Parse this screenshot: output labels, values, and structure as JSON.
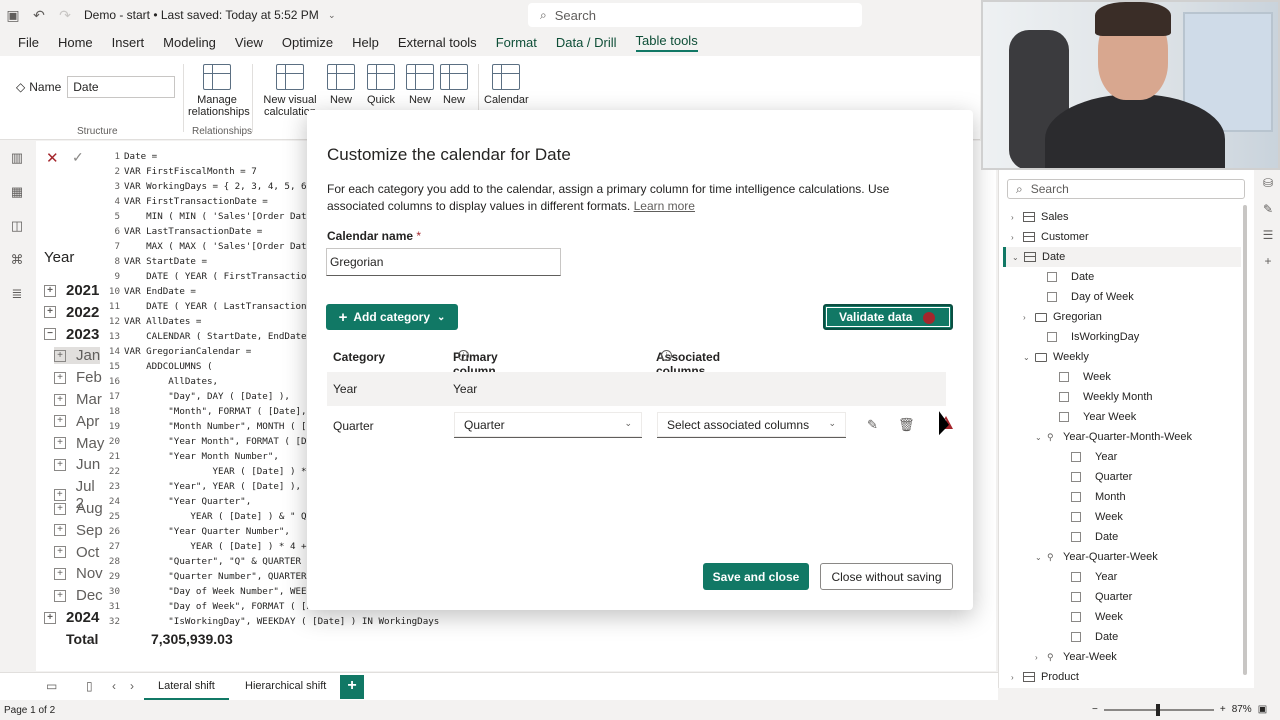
{
  "titlebar": {
    "title": "Demo - start • Last saved: Today at 5:52 PM",
    "search_placeholder": "Search"
  },
  "menu": [
    "File",
    "Home",
    "Insert",
    "Modeling",
    "View",
    "Optimize",
    "Help",
    "External tools",
    "Format",
    "Data / Drill",
    "Table tools"
  ],
  "ribbon": {
    "name_label": "Name",
    "name_value": "Date",
    "structure_label": "Structure",
    "relationships_label": "Relationships",
    "manage_rel_line1": "Manage",
    "manage_rel_line2": "relationships",
    "new_visual_line1": "New visual",
    "new_visual_line2": "calculation",
    "btn_new1": "New",
    "btn_quick": "Quick",
    "btn_new2": "New",
    "btn_new3": "New",
    "btn_calendar": "Calendar"
  },
  "code_lines": [
    {
      "n": "1",
      "t": "Date ="
    },
    {
      "n": "2",
      "t": "VAR FirstFiscalMonth = 7"
    },
    {
      "n": "3",
      "t": "VAR WorkingDays = { 2, 3, 4, 5, 6"
    },
    {
      "n": "4",
      "t": "VAR FirstTransactionDate ="
    },
    {
      "n": "5",
      "t": "    MIN ( MIN ( 'Sales'[Order Date"
    },
    {
      "n": "6",
      "t": "VAR LastTransactionDate ="
    },
    {
      "n": "7",
      "t": "    MAX ( MAX ( 'Sales'[Order Date"
    },
    {
      "n": "8",
      "t": "VAR StartDate ="
    },
    {
      "n": "9",
      "t": "    DATE ( YEAR ( FirstTransaction"
    },
    {
      "n": "10",
      "t": "VAR EndDate ="
    },
    {
      "n": "11",
      "t": "    DATE ( YEAR ( LastTransaction"
    },
    {
      "n": "12",
      "t": "VAR AllDates ="
    },
    {
      "n": "13",
      "t": "    CALENDAR ( StartDate, EndDate"
    },
    {
      "n": "14",
      "t": "VAR GregorianCalendar ="
    },
    {
      "n": "15",
      "t": "    ADDCOLUMNS ("
    },
    {
      "n": "16",
      "t": "        AllDates,"
    },
    {
      "n": "17",
      "t": "        \"Day\", DAY ( [Date] ),"
    },
    {
      "n": "18",
      "t": "        \"Month\", FORMAT ( [Date],"
    },
    {
      "n": "19",
      "t": "        \"Month Number\", MONTH ( [D"
    },
    {
      "n": "20",
      "t": "        \"Year Month\", FORMAT ( [D"
    },
    {
      "n": "21",
      "t": "        \"Year Month Number\","
    },
    {
      "n": "22",
      "t": "                YEAR ( [Date] ) *"
    },
    {
      "n": "23",
      "t": "        \"Year\", YEAR ( [Date] ),"
    },
    {
      "n": "24",
      "t": "        \"Year Quarter\","
    },
    {
      "n": "25",
      "t": "            YEAR ( [Date] ) & \" Q"
    },
    {
      "n": "26",
      "t": "        \"Year Quarter Number\","
    },
    {
      "n": "27",
      "t": "            YEAR ( [Date] ) * 4 +"
    },
    {
      "n": "28",
      "t": "        \"Quarter\", \"Q\" & QUARTER"
    },
    {
      "n": "29",
      "t": "        \"Quarter Number\", QUARTER"
    },
    {
      "n": "30",
      "t": "        \"Day of Week Number\", WEEK"
    },
    {
      "n": "31",
      "t": "        \"Day of Week\", FORMAT ( [D"
    },
    {
      "n": "32",
      "t": "        \"IsWorkingDay\", WEEKDAY ( [Date] ) IN WorkingDays"
    }
  ],
  "matrix": {
    "header": "Year",
    "rows": [
      {
        "box": "+",
        "label": "2021",
        "bold": true
      },
      {
        "box": "+",
        "label": "2022",
        "bold": true
      },
      {
        "box": "−",
        "label": "2023",
        "bold": true
      },
      {
        "box": "+",
        "label": "Jan",
        "bold": false,
        "sel": true
      },
      {
        "box": "+",
        "label": "Feb",
        "bold": false
      },
      {
        "box": "+",
        "label": "Mar",
        "bold": false
      },
      {
        "box": "+",
        "label": "Apr",
        "bold": false
      },
      {
        "box": "+",
        "label": "May",
        "bold": false
      },
      {
        "box": "+",
        "label": "Jun",
        "bold": false
      },
      {
        "box": "+",
        "label": "Jul 2",
        "bold": false
      },
      {
        "box": "+",
        "label": "Aug",
        "bold": false
      },
      {
        "box": "+",
        "label": "Sep",
        "bold": false
      },
      {
        "box": "+",
        "label": "Oct",
        "bold": false
      },
      {
        "box": "+",
        "label": "Nov",
        "bold": false
      },
      {
        "box": "+",
        "label": "Dec",
        "bold": false
      },
      {
        "box": "+",
        "label": "2024",
        "bold": true
      }
    ],
    "total_label": "Total",
    "total_value": "7,305,939.03"
  },
  "dialog": {
    "title": "Customize the calendar for Date",
    "description": "For each category you add to the calendar, assign a primary column for time intelligence calculations. Use associated columns to display values in different formats.",
    "learn_more": "Learn more",
    "calendar_name_label": "Calendar name",
    "required_mark": "*",
    "calendar_name_value": "Gregorian",
    "add_category": "Add category",
    "validate": "Validate data",
    "headers": {
      "category": "Category",
      "primary": "Primary column",
      "associated": "Associated columns"
    },
    "row_year": {
      "category": "Year",
      "primary": "Year"
    },
    "row_quarter": {
      "category": "Quarter",
      "primary": "Quarter",
      "associated_placeholder": "Select associated columns"
    },
    "save": "Save and close",
    "close": "Close without saving"
  },
  "rightpanel": {
    "search_placeholder": "Search",
    "tree": [
      {
        "indent": 0,
        "chev": "›",
        "icon": "table",
        "label": "Sales"
      },
      {
        "indent": 0,
        "chev": "›",
        "icon": "table",
        "label": "Customer"
      },
      {
        "indent": 0,
        "chev": "⌄",
        "icon": "table",
        "label": "Date",
        "sel": true
      },
      {
        "indent": 2,
        "chev": "",
        "icon": "cb",
        "label": "Date"
      },
      {
        "indent": 2,
        "chev": "",
        "icon": "cb",
        "label": "Day of Week"
      },
      {
        "indent": 1,
        "chev": "›",
        "icon": "folder",
        "label": "Gregorian"
      },
      {
        "indent": 2,
        "chev": "",
        "icon": "cb",
        "label": "IsWorkingDay"
      },
      {
        "indent": 1,
        "chev": "⌄",
        "icon": "folder",
        "label": "Weekly"
      },
      {
        "indent": 3,
        "chev": "",
        "icon": "cb",
        "label": "Week"
      },
      {
        "indent": 3,
        "chev": "",
        "icon": "cb",
        "label": "Weekly Month"
      },
      {
        "indent": 3,
        "chev": "",
        "icon": "cb",
        "label": "Year Week"
      },
      {
        "indent": 2,
        "chev": "⌄",
        "icon": "hier",
        "label": "Year-Quarter-Month-Week"
      },
      {
        "indent": 4,
        "chev": "",
        "icon": "cb",
        "label": "Year"
      },
      {
        "indent": 4,
        "chev": "",
        "icon": "cb",
        "label": "Quarter"
      },
      {
        "indent": 4,
        "chev": "",
        "icon": "cb",
        "label": "Month"
      },
      {
        "indent": 4,
        "chev": "",
        "icon": "cb",
        "label": "Week"
      },
      {
        "indent": 4,
        "chev": "",
        "icon": "cb",
        "label": "Date"
      },
      {
        "indent": 2,
        "chev": "⌄",
        "icon": "hier",
        "label": "Year-Quarter-Week"
      },
      {
        "indent": 4,
        "chev": "",
        "icon": "cb",
        "label": "Year"
      },
      {
        "indent": 4,
        "chev": "",
        "icon": "cb",
        "label": "Quarter"
      },
      {
        "indent": 4,
        "chev": "",
        "icon": "cb",
        "label": "Week"
      },
      {
        "indent": 4,
        "chev": "",
        "icon": "cb",
        "label": "Date"
      },
      {
        "indent": 2,
        "chev": "›",
        "icon": "hier",
        "label": "Year-Week"
      },
      {
        "indent": 0,
        "chev": "›",
        "icon": "table",
        "label": "Product"
      }
    ]
  },
  "tabs": [
    "Lateral shift",
    "Hierarchical shift"
  ],
  "status": {
    "page": "Page 1 of 2",
    "zoom": "87%"
  },
  "colors": {
    "accent": "#117865",
    "error": "#a4262c"
  }
}
